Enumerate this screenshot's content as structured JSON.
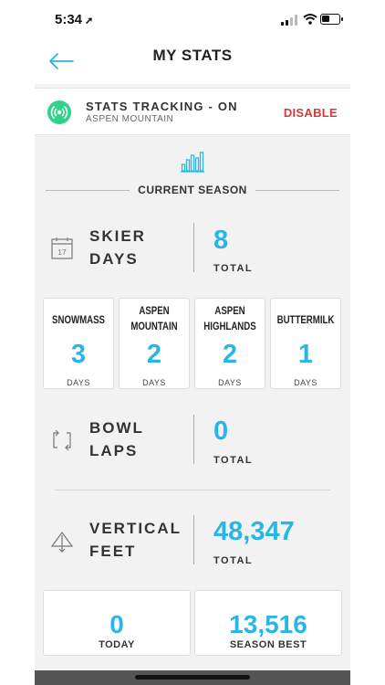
{
  "status_bar": {
    "time": "5:34",
    "location_glyph": "➚"
  },
  "header": {
    "title": "MY STATS",
    "back_icon": "arrow-left-icon"
  },
  "tracking": {
    "title": "STATS TRACKING - ON",
    "location": "ASPEN MOUNTAIN",
    "action": "DISABLE",
    "accent": "#2fd18b"
  },
  "season": {
    "label": "CURRENT SEASON"
  },
  "skier_days": {
    "label_1": "SKIER",
    "label_2": "DAYS",
    "value": "8",
    "unit": "TOTAL",
    "calendar_number": "17"
  },
  "mountains": [
    {
      "name_1": "SNOWMASS",
      "name_2": "",
      "value": "3",
      "unit": "DAYS"
    },
    {
      "name_1": "ASPEN",
      "name_2": "MOUNTAIN",
      "value": "2",
      "unit": "DAYS"
    },
    {
      "name_1": "ASPEN",
      "name_2": "HIGHLANDS",
      "value": "2",
      "unit": "DAYS"
    },
    {
      "name_1": "BUTTERMILK",
      "name_2": "",
      "value": "1",
      "unit": "DAYS"
    }
  ],
  "bowl_laps": {
    "label_1": "BOWL",
    "label_2": "LAPS",
    "value": "0",
    "unit": "TOTAL"
  },
  "vertical_feet": {
    "label_1": "VERTICAL",
    "label_2": "FEET",
    "value": "48,347",
    "unit": "TOTAL"
  },
  "today": {
    "value": "0",
    "label": "TODAY"
  },
  "season_best": {
    "value": "13,516",
    "label": "SEASON BEST"
  },
  "colors": {
    "accent_blue": "#29b6e6",
    "danger_red": "#d33a3a",
    "background": "#f2f2f2"
  }
}
